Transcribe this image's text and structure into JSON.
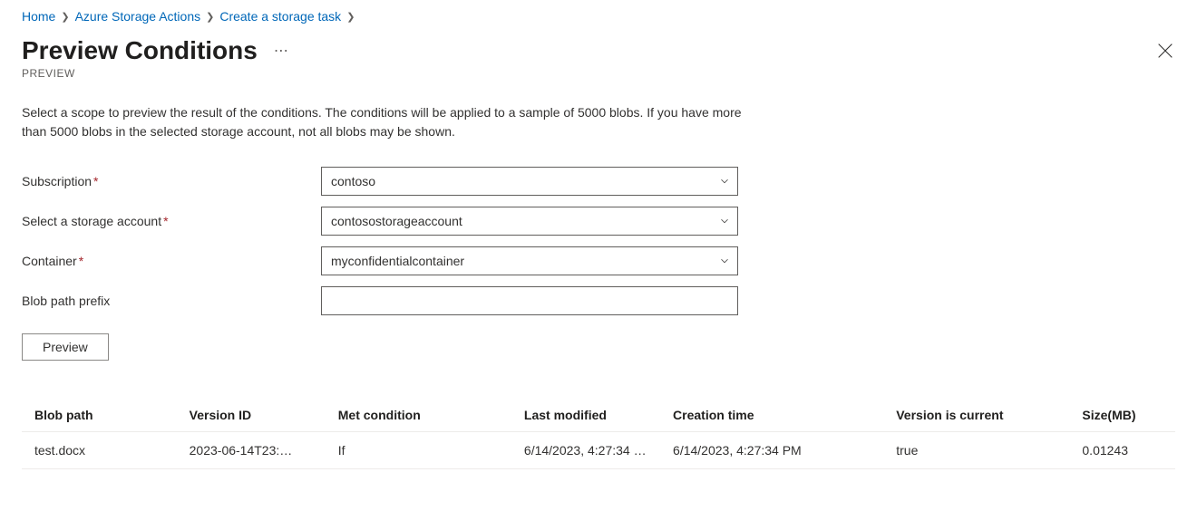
{
  "breadcrumb": {
    "items": [
      {
        "label": "Home"
      },
      {
        "label": "Azure Storage Actions"
      },
      {
        "label": "Create a storage task"
      }
    ]
  },
  "page": {
    "title": "Preview Conditions",
    "subtitle": "PREVIEW",
    "description": "Select a scope to preview the result of the conditions. The conditions will be applied to a sample of 5000 blobs. If you have more than 5000 blobs in the selected storage account, not all blobs may be shown."
  },
  "form": {
    "subscription": {
      "label": "Subscription",
      "required": true,
      "value": "contoso"
    },
    "storage_account": {
      "label": "Select a storage account",
      "required": true,
      "value": "contosostorageaccount"
    },
    "container": {
      "label": "Container",
      "required": true,
      "value": "myconfidentialcontainer"
    },
    "blob_prefix": {
      "label": "Blob path prefix",
      "required": false,
      "value": ""
    },
    "preview_button": "Preview"
  },
  "table": {
    "headers": {
      "blob_path": "Blob path",
      "version_id": "Version ID",
      "met_condition": "Met condition",
      "last_modified": "Last modified",
      "creation_time": "Creation time",
      "version_current": "Version is current",
      "size": "Size(MB)"
    },
    "rows": [
      {
        "blob_path": "test.docx",
        "version_id": "2023-06-14T23:…",
        "met_condition": "If",
        "last_modified": "6/14/2023, 4:27:34 …",
        "creation_time": "6/14/2023, 4:27:34 PM",
        "version_current": "true",
        "size": "0.01243"
      }
    ]
  },
  "required_marker": "*"
}
